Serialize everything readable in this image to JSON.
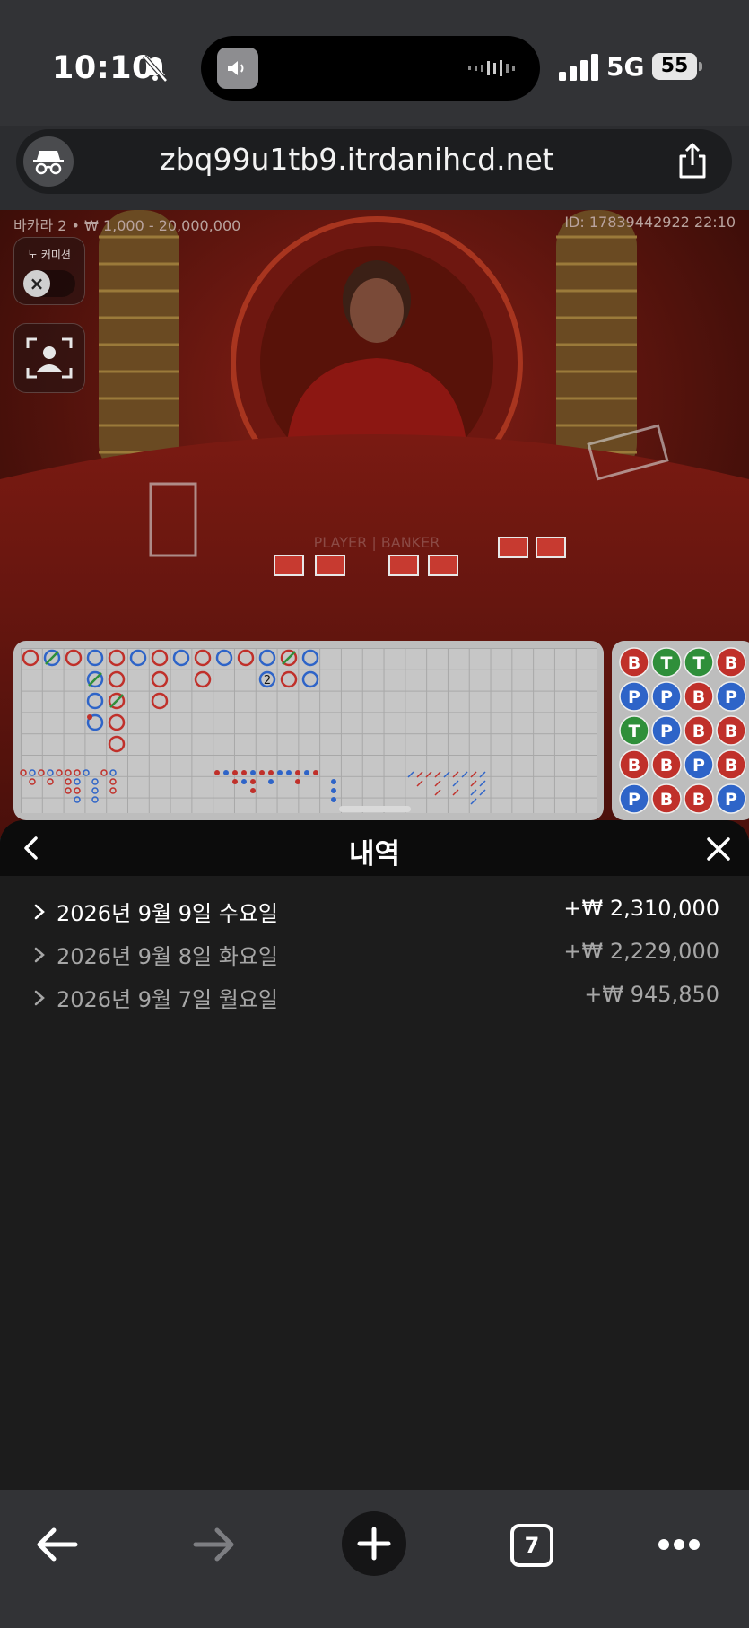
{
  "status": {
    "time": "10:10",
    "network": "5G",
    "battery": "55"
  },
  "browser": {
    "url": "zbq99u1tb9.itrdanihcd.net",
    "tab_count": "7"
  },
  "game": {
    "table_info": "바카라 2 • ₩ 1,000 - 20,000,000",
    "round_id": "ID: 17839442922 22:10",
    "no_commission_label": "노 커미션",
    "table_text": "PLAYER | BANKER",
    "bead_badge": "2",
    "bead_road": [
      [
        "B",
        "T",
        "T",
        "B"
      ],
      [
        "P",
        "P",
        "B",
        "P"
      ],
      [
        "T",
        "P",
        "B",
        "B"
      ],
      [
        "B",
        "B",
        "P",
        "B"
      ],
      [
        "P",
        "B",
        "B",
        "P"
      ]
    ]
  },
  "history": {
    "title": "내역",
    "items": [
      {
        "date": "2026년 9월 9일 수요일",
        "amount": "+₩ 2,310,000"
      },
      {
        "date": "2026년 9월 8일 화요일",
        "amount": "+₩ 2,229,000"
      },
      {
        "date": "2026년 9월 7일 월요일",
        "amount": "+₩ 945,850"
      }
    ]
  },
  "colors": {
    "banker": "#c0302a",
    "player": "#2e64c8",
    "tie": "#2f8f3a",
    "panel_bg": "#1c1c1c",
    "header_bg": "#0c0c0c",
    "browser_chrome": "#323336"
  }
}
